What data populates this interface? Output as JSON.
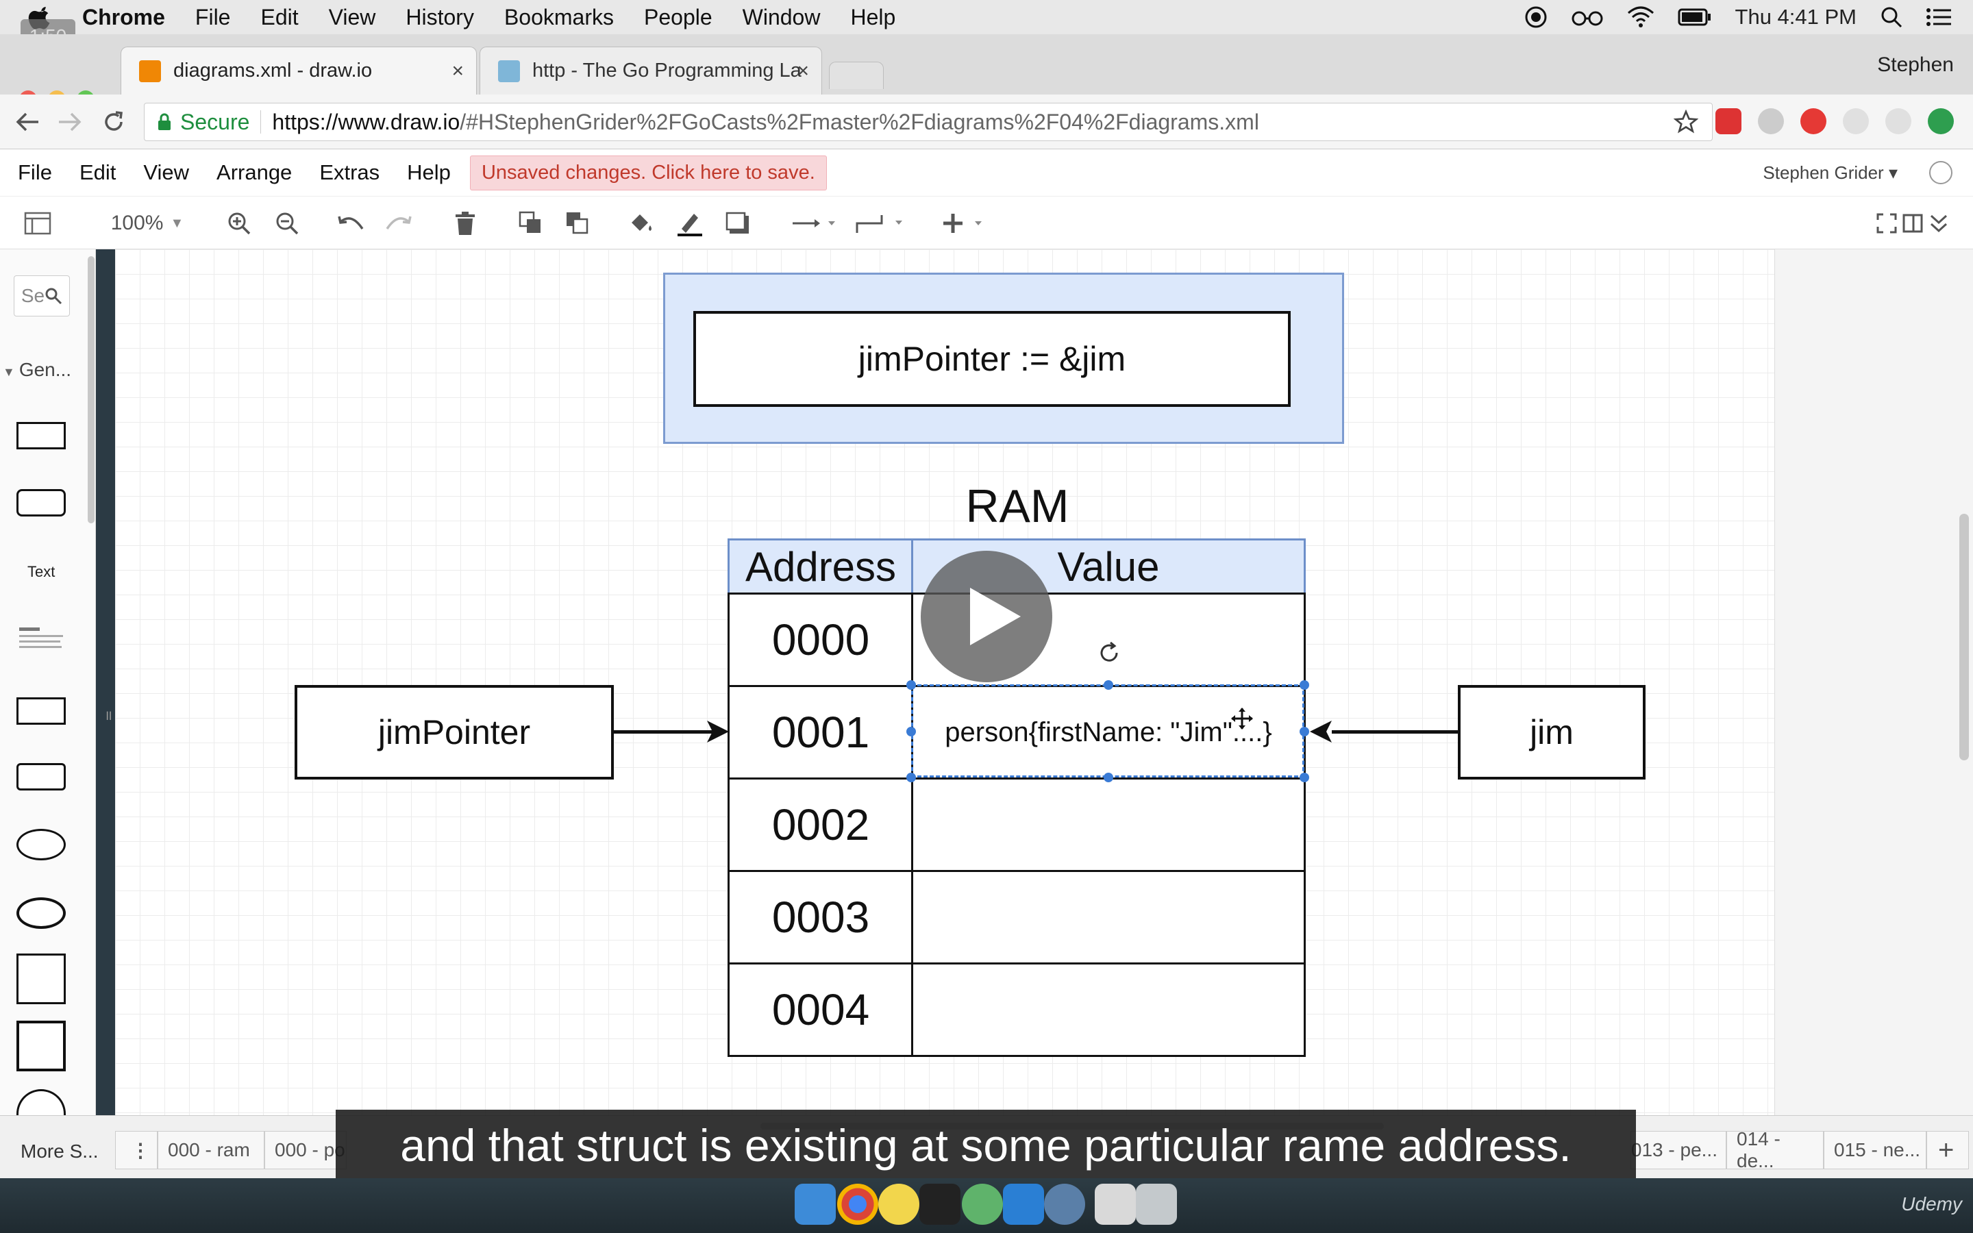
{
  "menubar": {
    "app": "Chrome",
    "items": [
      "File",
      "Edit",
      "View",
      "History",
      "Bookmarks",
      "People",
      "Window",
      "Help"
    ],
    "clock": "Thu 4:41 PM"
  },
  "overlay": {
    "timer": "1:50"
  },
  "tabs": [
    {
      "title": "diagrams.xml - draw.io",
      "close": "×"
    },
    {
      "title": "http - The Go Programming La",
      "close": "×"
    }
  ],
  "profile": "Stephen",
  "addressbar": {
    "secure_label": "Secure",
    "url_host": "https://www.draw.io",
    "url_rest": "/#HStephenGrider%2FGoCasts%2Fmaster%2Fdiagrams%2F04%2Fdiagrams.xml"
  },
  "drawio_menu": {
    "items": [
      "File",
      "Edit",
      "View",
      "Arrange",
      "Extras",
      "Help"
    ],
    "unsaved": "Unsaved changes. Click here to save.",
    "user": "Stephen Grider ▾"
  },
  "toolbar": {
    "zoom": "100%"
  },
  "sidebar": {
    "search_placeholder": "Se",
    "general": "Gen...",
    "text_shape": "Text"
  },
  "diagram": {
    "top_statement": "jimPointer := &jim",
    "ram_title": "RAM",
    "headers": [
      "Address",
      "Value"
    ],
    "addresses": [
      "0000",
      "0001",
      "0002",
      "0003",
      "0004"
    ],
    "values": [
      "",
      "person{firstName: \"Jim\"....}",
      "",
      "",
      ""
    ],
    "left_box": "jimPointer",
    "right_box": "jim"
  },
  "bottom": {
    "more_shapes": "More S...",
    "page_tabs": [
      "000 - ram",
      "000 - po",
      "013 - pe...",
      "014 - de...",
      "015 - ne..."
    ]
  },
  "subtitle": "and that struct is existing at some particular rame address.",
  "dock": {
    "brand": "Udemy"
  }
}
